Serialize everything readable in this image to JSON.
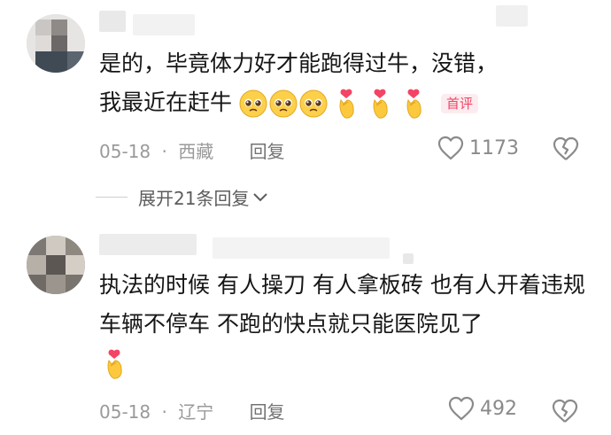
{
  "comments": [
    {
      "text": "是的，毕竟体力好才能跑得过牛，没错，我最近在赶牛",
      "emojis": [
        "pleading-face",
        "pleading-face",
        "pleading-face",
        "finger-heart",
        "finger-heart",
        "finger-heart"
      ],
      "badge": "首评",
      "date": "05-18",
      "sep": "·",
      "location": "西藏",
      "reply_label": "回复",
      "likes": "1173",
      "expand_label": "展开21条回复"
    },
    {
      "text": "执法的时候 有人操刀 有人拿板砖 也有人开着违规车辆不停车 不跑的快点就只能医院见了",
      "emojis": [
        "finger-heart"
      ],
      "date": "05-18",
      "sep": "·",
      "location": "辽宁",
      "reply_label": "回复",
      "likes": "492"
    }
  ],
  "colors": {
    "badge_bg": "#fdecef",
    "badge_text": "#ee4565",
    "meta": "#9a9a9a",
    "text": "#161616"
  }
}
